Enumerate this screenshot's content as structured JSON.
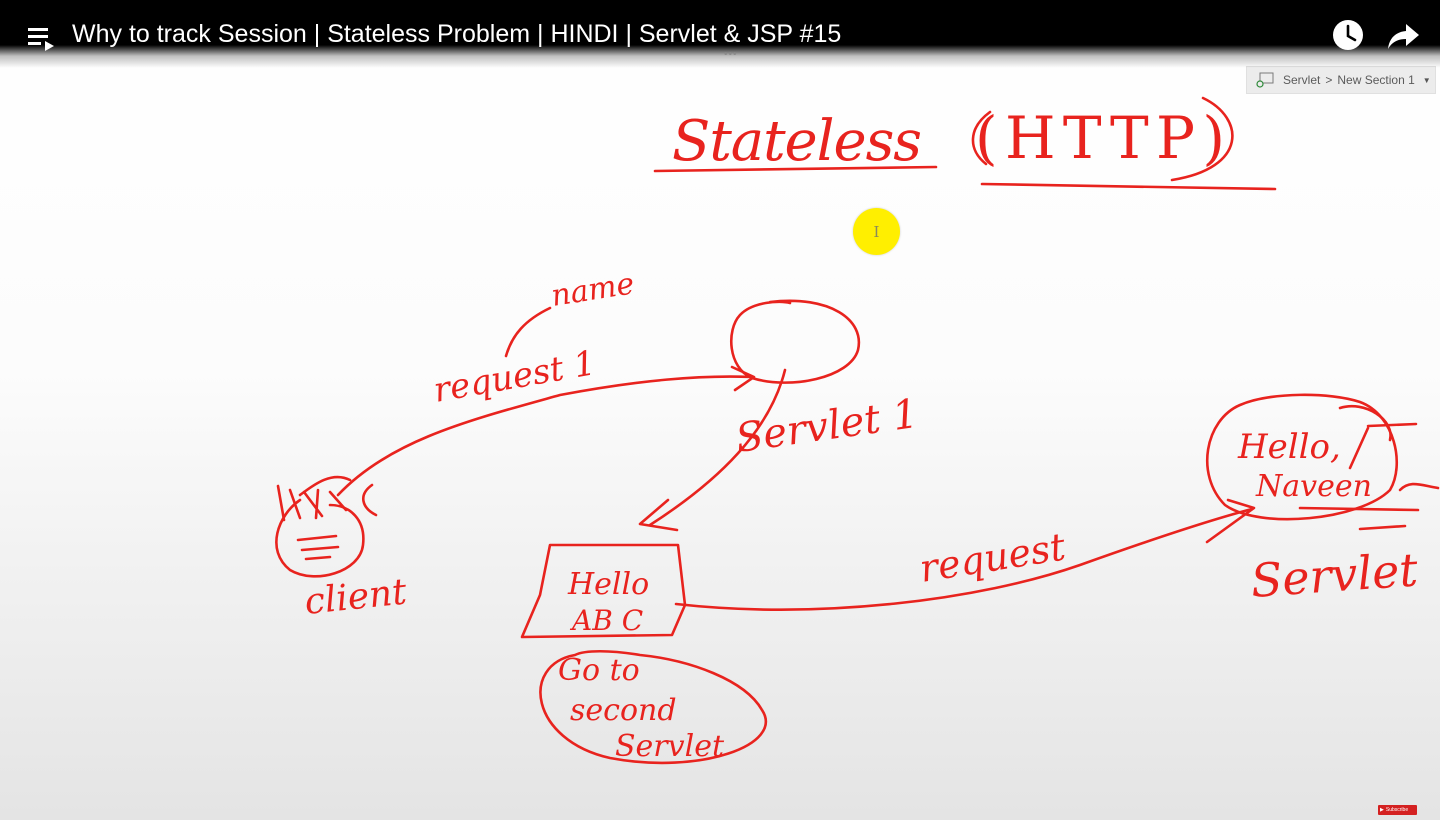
{
  "video": {
    "title": "Why to track Session | Stateless Problem | HINDI | Servlet & JSP #15"
  },
  "icons": {
    "playlist": "playlist-icon",
    "watch_later": "clock-icon",
    "share": "share-arrow-icon"
  },
  "breadcrumb": {
    "notebook": "Servlet",
    "separator": ">",
    "section": "New Section 1"
  },
  "drawing": {
    "ink_color": "#e8231e",
    "cursor_color": "#ffef00",
    "heading": "Stateless",
    "heading_paren": "(HTTP)",
    "name_label": "name",
    "request_label": "request 1",
    "servlet_label": "Servlet 1",
    "client_label": "client",
    "box_text_line1": "Hello",
    "box_text_line2": "AB C",
    "note_line1": "Go to",
    "note_line2": "second",
    "note_line3": "Servlet",
    "request2_label": "request",
    "circle2_line1": "Hello,",
    "circle2_line2": "Naveen",
    "servlet2_label": "Servlet"
  },
  "subscribe": {
    "label": "Subscribe"
  }
}
